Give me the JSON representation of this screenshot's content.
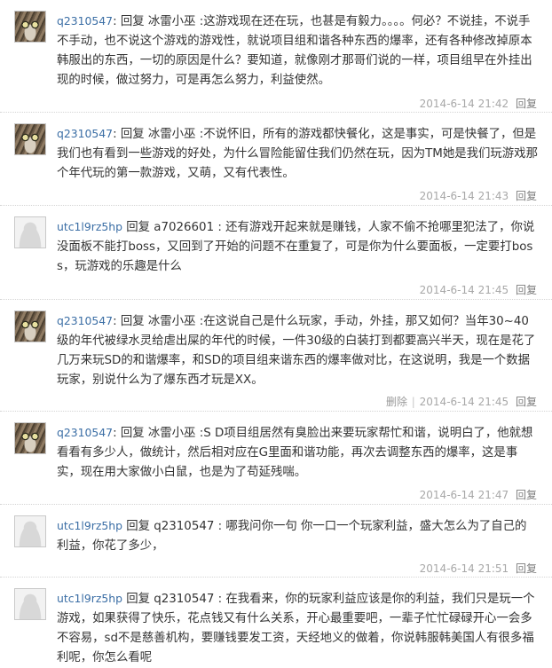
{
  "comments": [
    {
      "user": "q2310547",
      "text": "回复 冰雷小巫 :这游戏现在还在玩，也甚是有毅力。。。。何必？不说挂，不说手不手动，也不说这个游戏的游戏性，就说项目组和谐各种东西的爆率，还有各种修改掉原本韩服出的东西，一切的原因是什么？要知道，就像刚才那哥们说的一样，项目组早在外挂出现的时候，做过努力，可是再怎么努力，利益使然。",
      "time": "2014-6-14 21:42",
      "reply_label": "回复"
    },
    {
      "user": "q2310547",
      "text": "回复 冰雷小巫 :不说怀旧，所有的游戏都快餐化，这是事实，可是快餐了，但是我们也有看到一些游戏的好处，为什么冒险能留住我们仍然在玩，因为TM她是我们玩游戏那个年代玩的第一款游戏，又萌，又有代表性。",
      "time": "2014-6-14 21:43",
      "reply_label": "回复"
    },
    {
      "user": "utc1l9rz5hp",
      "text": "回复 a7026601 : 还有游戏开起来就是赚钱，人家不偷不抢哪里犯法了，你说没面板不能打boss，又回到了开始的问题不在重复了，可是你为什么要面板，一定要打boss，玩游戏的乐趣是什么",
      "time": "2014-6-14 21:45",
      "reply_label": "回复"
    },
    {
      "user": "q2310547",
      "text": "回复 冰雷小巫 :在这说自己是什么玩家，手动，外挂，那又如何？当年30~40级的年代被绿水灵给虐出屎的年代的时候，一件30级的白装打到都要高兴半天，现在是花了几万来玩SD的和谐爆率，和SD的项目组来谐东西的爆率做对比，在这说明，我是一个数据玩家，别说什么为了爆东西才玩是XX。",
      "delete_label": "删除",
      "time": "2014-6-14 21:45",
      "reply_label": "回复"
    },
    {
      "user": "q2310547",
      "text": "回复 冰雷小巫 :S D项目组居然有臭脸出来要玩家帮忙和谐，说明白了，他就想看看有多少人，做统计，然后相对应在G里面和谐功能，再次去调整东西的爆率，这是事实，现在用大家做小白鼠，也是为了苟延残喘。",
      "time": "2014-6-14 21:47",
      "reply_label": "回复"
    },
    {
      "user": "utc1l9rz5hp",
      "text": "回复 q2310547 : 哪我问你一句 你一口一个玩家利益，盛大怎么为了自己的利益，你花了多少，",
      "time": "2014-6-14 21:51",
      "reply_label": "回复"
    },
    {
      "user": "utc1l9rz5hp",
      "text": "回复 q2310547 : 在我看来，你的玩家利益应该是你的利益，我们只是玩一个游戏，如果获得了快乐，花点钱又有什么关系，开心最重要吧，一辈子忙忙碌碌开心一会多不容易，sd不是慈善机构，要赚钱要发工资，天经地义的做着，你说韩服韩美国人有很多福利呢，你怎么看呢",
      "time": "",
      "reply_label": ""
    }
  ]
}
